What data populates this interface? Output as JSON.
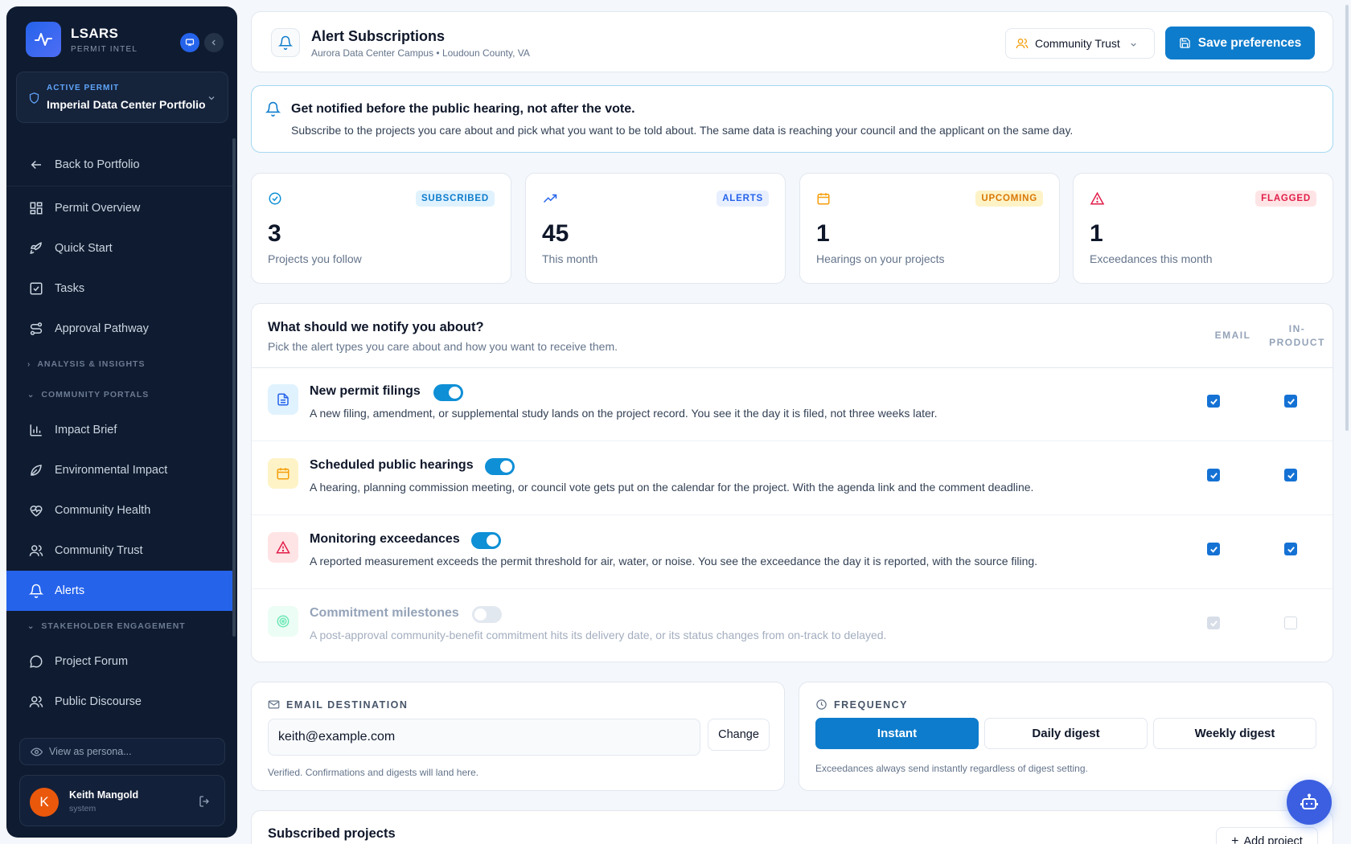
{
  "brand": {
    "name": "LSARS",
    "subtitle": "PERMIT INTEL"
  },
  "active_permit": {
    "label": "ACTIVE PERMIT",
    "name": "Imperial Data Center Portfolio"
  },
  "nav": {
    "back": "Back to Portfolio",
    "items": [
      "Permit Overview",
      "Quick Start",
      "Tasks",
      "Approval Pathway"
    ],
    "sections": [
      "ANALYSIS & INSIGHTS",
      "COMMUNITY PORTALS",
      "STAKEHOLDER ENGAGEMENT"
    ],
    "portal_items": [
      "Impact Brief",
      "Environmental Impact",
      "Community Health",
      "Community Trust",
      "Alerts"
    ],
    "engagement_items": [
      "Project Forum",
      "Public Discourse"
    ]
  },
  "persona_view": "View as persona...",
  "user": {
    "initial": "K",
    "name": "Keith Mangold",
    "role": "system"
  },
  "header": {
    "title": "Alert Subscriptions",
    "subtitle": "Aurora Data Center Campus • Loudoun County, VA",
    "persona": "Community Trust",
    "save_label": "Save preferences"
  },
  "banner": {
    "title": "Get notified before the public hearing, not after the vote.",
    "text": "Subscribe to the projects you care about and pick what you want to be told about. The same data is reaching your council and the applicant on the same day."
  },
  "stats": [
    {
      "badge": "SUBSCRIBED",
      "value": "3",
      "label": "Projects you follow",
      "color": "#0ea5e9"
    },
    {
      "badge": "ALERTS",
      "value": "45",
      "label": "This month",
      "color": "#2563eb"
    },
    {
      "badge": "UPCOMING",
      "value": "1",
      "label": "Hearings on your projects",
      "color": "#f59e0b"
    },
    {
      "badge": "FLAGGED",
      "value": "1",
      "label": "Exceedances this month",
      "color": "#e11d48"
    }
  ],
  "notify": {
    "title": "What should we notify you about?",
    "subtitle": "Pick the alert types you care about and how you want to receive them.",
    "col_email": "EMAIL",
    "col_inproduct_1": "IN-",
    "col_inproduct_2": "PRODUCT",
    "rows": [
      {
        "title": "New permit filings",
        "desc": "A new filing, amendment, or supplemental study lands on the project record. You see it the day it is filed, not three weeks later.",
        "enabled": true,
        "email": true,
        "in_product": true
      },
      {
        "title": "Scheduled public hearings",
        "desc": "A hearing, planning commission meeting, or council vote gets put on the calendar for the project. With the agenda link and the comment deadline.",
        "enabled": true,
        "email": true,
        "in_product": true
      },
      {
        "title": "Monitoring exceedances",
        "desc": "A reported measurement exceeds the permit threshold for air, water, or noise. You see the exceedance the day it is reported, with the source filing.",
        "enabled": true,
        "email": true,
        "in_product": true
      },
      {
        "title": "Commitment milestones",
        "desc": "A post-approval community-benefit commitment hits its delivery date, or its status changes from on-track to delayed.",
        "enabled": false,
        "email": true,
        "in_product": false
      }
    ]
  },
  "email_dest": {
    "heading": "EMAIL DESTINATION",
    "value": "keith@example.com",
    "change_label": "Change",
    "hint": "Verified. Confirmations and digests will land here."
  },
  "frequency": {
    "heading": "FREQUENCY",
    "options": [
      "Instant",
      "Daily digest",
      "Weekly digest"
    ],
    "selected": "Instant",
    "hint": "Exceedances always send instantly regardless of digest setting."
  },
  "subscribed": {
    "title": "Subscribed projects",
    "add_label": "Add project"
  }
}
